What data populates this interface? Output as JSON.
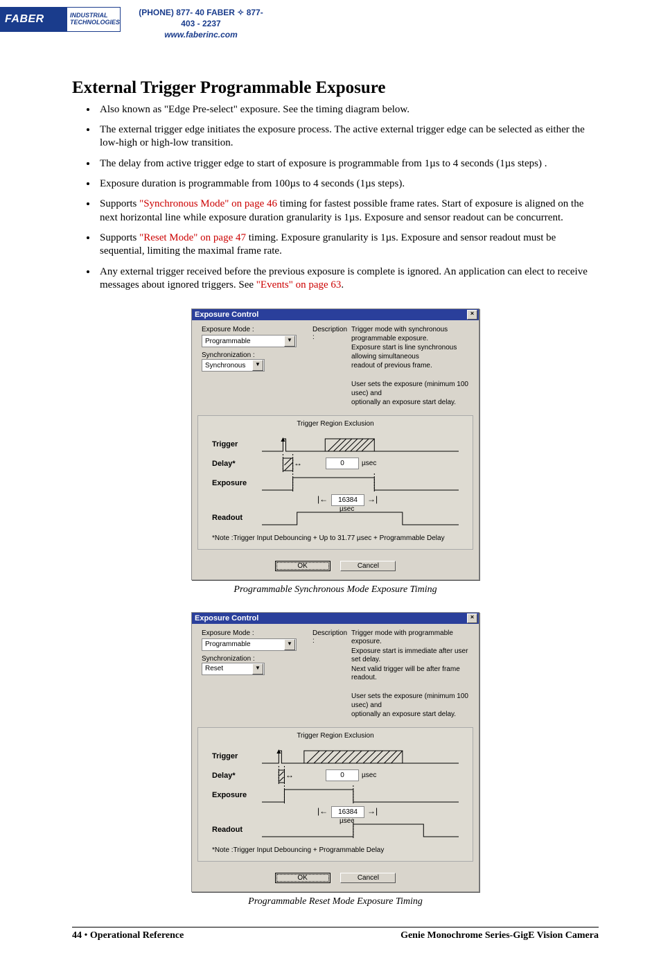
{
  "header": {
    "logo_main": "FABER",
    "logo_sub1": "INDUSTRIAL",
    "logo_sub2": "TECHNOLOGIES",
    "phone_line": "(PHONE) 877- 40 FABER  ✧  877- 403 - 2237",
    "url": "www.faberinc.com"
  },
  "title": "External Trigger Programmable Exposure",
  "bullets": [
    {
      "pre": "Also known as \"Edge Pre-select\" exposure. See the timing diagram below."
    },
    {
      "pre": "The external trigger edge initiates the exposure process. The active external trigger edge can be selected as either the low-high or high-low transition."
    },
    {
      "pre": "The delay from active trigger edge to start of exposure is programmable from 1µs to 4 seconds (1µs steps) ."
    },
    {
      "pre": "Exposure duration is programmable from 100µs to 4 seconds (1µs steps)."
    },
    {
      "pre": "Supports ",
      "xref": "\"Synchronous Mode\" on page 46",
      "post": " timing for fastest possible frame rates. Start of exposure is aligned on the next horizontal line while exposure duration granularity is 1µs. Exposure and sensor readout can be concurrent."
    },
    {
      "pre": "Supports ",
      "xref": "\"Reset Mode\" on page 47",
      "post": " timing. Exposure granularity is 1µs. Exposure and sensor readout must be sequential, limiting the maximal frame rate."
    },
    {
      "pre": "Any external trigger received before the previous exposure is complete is ignored. An application can elect to receive messages about ignored triggers. See ",
      "xref": "\"Events\" on page 63",
      "post": "."
    }
  ],
  "dialog1": {
    "title": "Exposure Control",
    "exp_mode_label": "Exposure Mode :",
    "exp_mode_value": "Programmable",
    "sync_label": "Synchronization :",
    "sync_value": "Synchronous",
    "desc_label": "Description :",
    "desc_lines": [
      "Trigger mode with synchronous programmable exposure.",
      "Exposure start is line synchronous allowing simultaneous",
      "readout of previous frame.",
      "",
      "User sets the exposure (minimum 100 usec) and",
      "optionally an exposure start delay."
    ],
    "panel_title": "Trigger Region Exclusion",
    "rows": {
      "trigger": "Trigger",
      "delay": "Delay*",
      "exposure": "Exposure",
      "readout": "Readout"
    },
    "delay_value": "0",
    "delay_unit": "µsec",
    "exp_value": "16384",
    "exp_unit": "µsec",
    "note": "*Note :Trigger Input Debouncing + Up to  31.77  µsec + Programmable Delay",
    "ok": "OK",
    "cancel": "Cancel"
  },
  "caption1": "Programmable Synchronous Mode Exposure Timing",
  "dialog2": {
    "title": "Exposure Control",
    "exp_mode_label": "Exposure Mode :",
    "exp_mode_value": "Programmable",
    "sync_label": "Synchronization :",
    "sync_value": "Reset",
    "desc_label": "Description :",
    "desc_lines": [
      "Trigger mode with programmable exposure.",
      "Exposure start is immediate after user set delay.",
      "Next valid trigger will be after frame readout.",
      "",
      "User sets the exposure (minimum 100 usec) and",
      "optionally an exposure start delay."
    ],
    "panel_title": "Trigger Region Exclusion",
    "rows": {
      "trigger": "Trigger",
      "delay": "Delay*",
      "exposure": "Exposure",
      "readout": "Readout"
    },
    "delay_value": "0",
    "delay_unit": "µsec",
    "exp_value": "16384",
    "exp_unit": "µsec",
    "note": "*Note :Trigger Input Debouncing + Programmable Delay",
    "ok": "OK",
    "cancel": "Cancel"
  },
  "caption2": "Programmable Reset Mode Exposure Timing",
  "footer": {
    "page_num": "44",
    "section": "Operational Reference",
    "doc_title": "Genie Monochrome Series-GigE Vision Camera"
  }
}
